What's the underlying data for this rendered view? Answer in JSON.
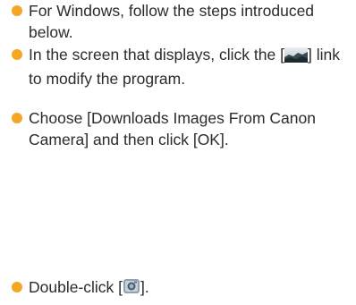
{
  "steps": [
    {
      "text": "For Windows, follow the steps introduced below."
    },
    {
      "before": "In the screen that displays, click the [",
      "icon": "landscape-image-icon",
      "after": "] link to modify the program."
    },
    {
      "text": "Choose [Downloads Images From Canon Camera] and then click [OK]."
    },
    {
      "before": "Double-click [",
      "icon": "camera-app-icon",
      "after": "]."
    }
  ],
  "colors": {
    "bullet": "#f5a623",
    "text": "#2b2b2b"
  }
}
